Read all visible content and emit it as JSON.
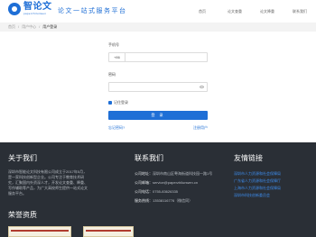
{
  "header": {
    "logo_cn": "智论文",
    "logo_en": "paperzhilunwen",
    "slogan": "论文一站式服务平台",
    "nav": [
      "首页",
      "论文查重",
      "论文降重",
      "联系我们"
    ]
  },
  "breadcrumb": [
    "首页",
    "用户中心",
    "用户登录"
  ],
  "form": {
    "phone_label": "手机号",
    "phone_prefix": "+86",
    "phone_placeholder": "",
    "password_label": "密码",
    "password_placeholder": "",
    "remember_label": "记住登录",
    "login_button": "登 录",
    "forgot_link": "忘记密码?",
    "register_link": "注册用户"
  },
  "footer": {
    "about_title": "关于我们",
    "about_text": "深圳市智能论文科技有限公司成立于2017年5月，是一家科技创新型企业。公司专注于教育技术研究，汇聚国内外资深人才，开发论文查重、降重、写作辅助等产品，为广大高校师生提供一站式论文服务平台。",
    "contact_title": "联系我们",
    "contact": [
      {
        "label": "公司地址：",
        "value": "深圳市南山区粤海街道科技园一路1号"
      },
      {
        "label": "公司邮箱：",
        "value": "service@paperzhilunwen.cn"
      },
      {
        "label": "公司电话：",
        "value": "0755-83626335"
      },
      {
        "label": "服务热线：",
        "value": "13538116776（微信同）"
      }
    ],
    "links_title": "友情链接",
    "links": [
      "深圳市人力资源和社会保障局",
      "广东省人力资源和社会保障厅",
      "上海市人力资源和社会保障局",
      "深圳市科技创新委员会"
    ],
    "honor_title": "荣誉资质"
  }
}
